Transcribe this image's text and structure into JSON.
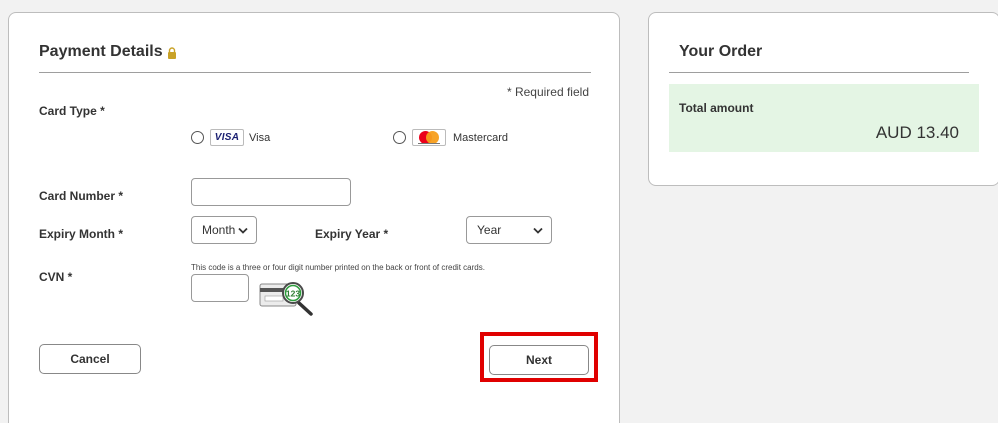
{
  "payment": {
    "title": "Payment Details",
    "required_note": "* Required field",
    "card_type_label": "Card Type *",
    "card_options": [
      {
        "name": "Visa",
        "logo_text": "VISA",
        "selected": false
      },
      {
        "name": "Mastercard",
        "selected": false
      }
    ],
    "card_number_label": "Card Number *",
    "card_number_value": "",
    "expiry_month_label": "Expiry Month *",
    "expiry_month_value": "Month",
    "expiry_year_label": "Expiry Year *",
    "expiry_year_value": "Year",
    "cvn_label": "CVN *",
    "cvn_help": "This code is a three or four digit number printed on the back or front of credit cards.",
    "cvn_value": "",
    "cvn_example": "123",
    "cancel_label": "Cancel",
    "next_label": "Next"
  },
  "order": {
    "title": "Your Order",
    "total_label": "Total amount",
    "total_value": "AUD 13.40"
  },
  "colors": {
    "highlight": "#e00000",
    "total_bg": "#e4f5e4",
    "visa_blue": "#1a1f71",
    "mc_red": "#eb001b",
    "mc_orange": "#f79e1b",
    "lock": "#c9a227"
  }
}
